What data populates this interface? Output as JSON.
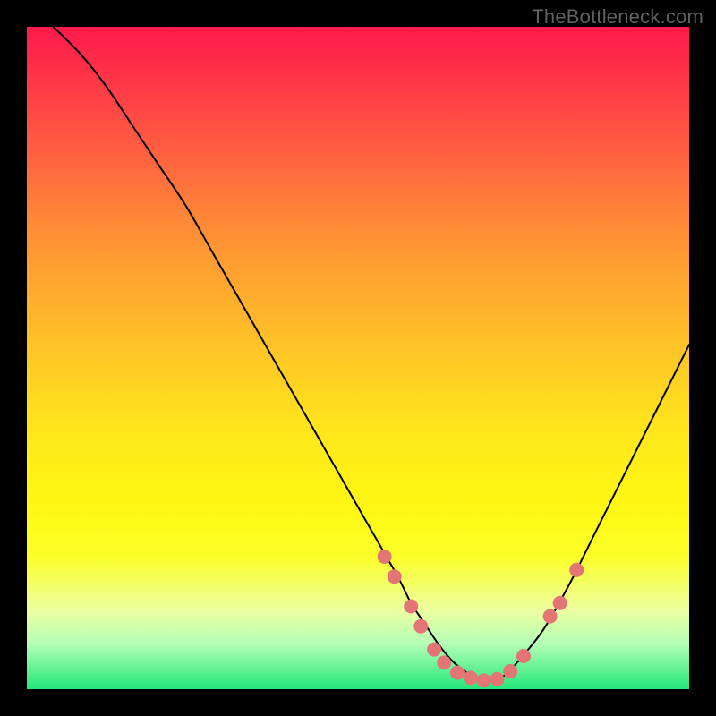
{
  "watermark": "TheBottleneck.com",
  "chart_data": {
    "type": "line",
    "title": "",
    "xlabel": "",
    "ylabel": "",
    "xlim": [
      0,
      100
    ],
    "ylim": [
      0,
      100
    ],
    "curve": {
      "x": [
        4,
        8,
        12,
        16,
        20,
        24,
        28,
        32,
        36,
        40,
        44,
        48,
        52,
        56,
        58,
        60,
        62,
        64,
        66,
        68,
        70,
        72,
        74,
        78,
        82,
        86,
        90,
        94,
        98,
        100
      ],
      "y": [
        100,
        96,
        91,
        85,
        79,
        73,
        66,
        59,
        52,
        45,
        38,
        31,
        24,
        17,
        13,
        10,
        7,
        4.5,
        2.8,
        1.7,
        1.3,
        2.0,
        4.0,
        9,
        16,
        24,
        32,
        40,
        48,
        52
      ]
    },
    "marker_color": "#e37574",
    "marker_radius_px": 8,
    "markers": [
      {
        "x": 54,
        "y": 20
      },
      {
        "x": 55.5,
        "y": 17
      },
      {
        "x": 58,
        "y": 12.5
      },
      {
        "x": 59.5,
        "y": 9.5
      },
      {
        "x": 61.5,
        "y": 6
      },
      {
        "x": 63,
        "y": 4
      },
      {
        "x": 65,
        "y": 2.5
      },
      {
        "x": 67,
        "y": 1.7
      },
      {
        "x": 69,
        "y": 1.3
      },
      {
        "x": 71,
        "y": 1.5
      },
      {
        "x": 73,
        "y": 2.7
      },
      {
        "x": 75,
        "y": 5
      },
      {
        "x": 79,
        "y": 11
      },
      {
        "x": 80.5,
        "y": 13
      },
      {
        "x": 83,
        "y": 18
      }
    ]
  }
}
